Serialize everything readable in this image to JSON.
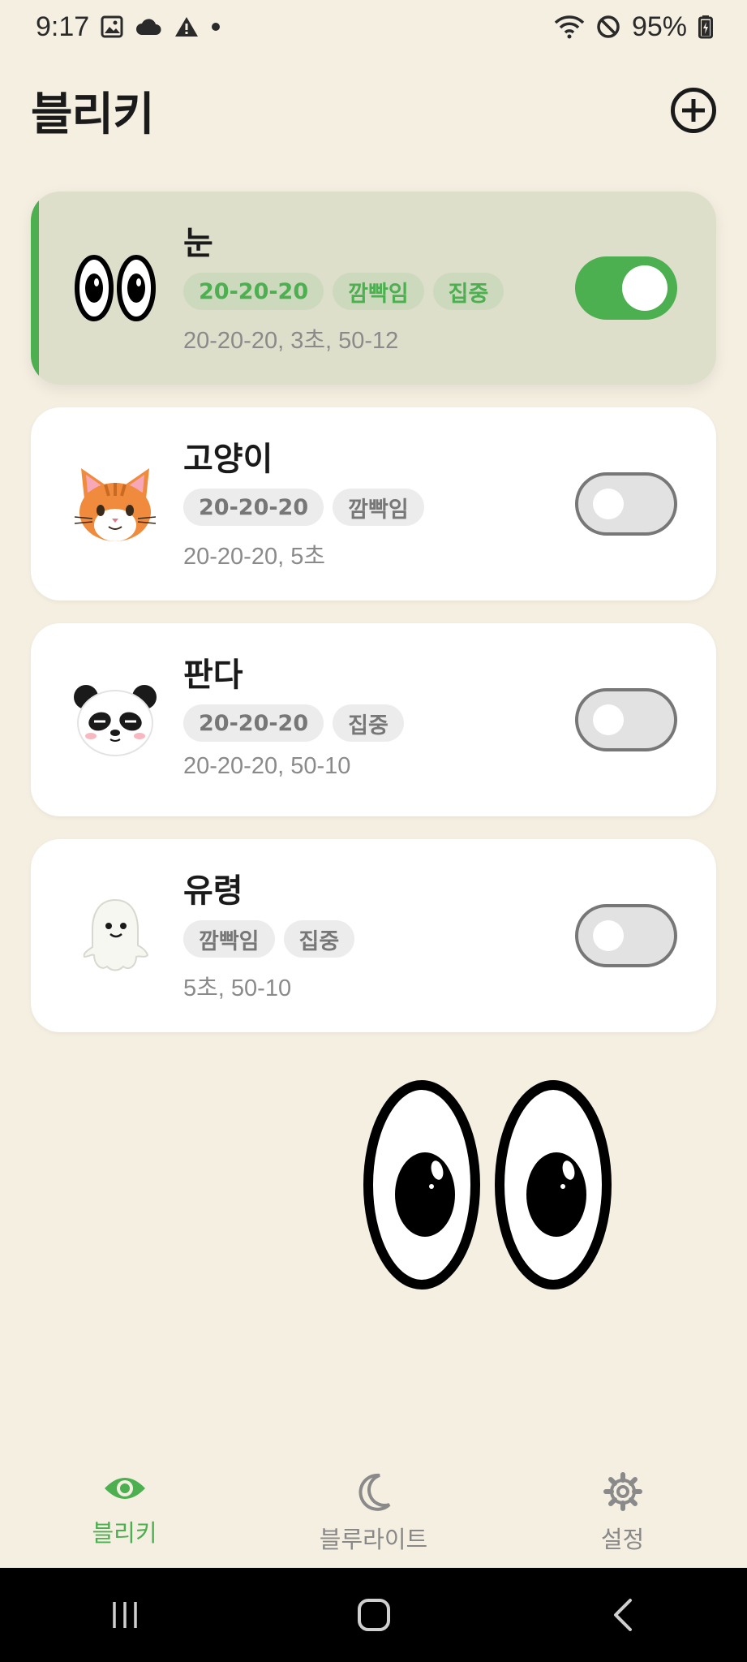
{
  "status_bar": {
    "time": "9:17",
    "battery": "95%"
  },
  "header": {
    "title": "블리키"
  },
  "cards": [
    {
      "name": "눈",
      "tags": [
        "20-20-20",
        "깜빡임",
        "집중"
      ],
      "summary": "20-20-20, 3초, 50-12",
      "enabled": true
    },
    {
      "name": "고양이",
      "tags": [
        "20-20-20",
        "깜빡임"
      ],
      "summary": "20-20-20, 5초",
      "enabled": false
    },
    {
      "name": "판다",
      "tags": [
        "20-20-20",
        "집중"
      ],
      "summary": "20-20-20, 50-10",
      "enabled": false
    },
    {
      "name": "유령",
      "tags": [
        "깜빡임",
        "집중"
      ],
      "summary": "5초, 50-10",
      "enabled": false
    }
  ],
  "nav": [
    {
      "label": "블리키",
      "icon": "eye-icon",
      "active": true
    },
    {
      "label": "블루라이트",
      "icon": "moon-icon",
      "active": false
    },
    {
      "label": "설정",
      "icon": "gear-icon",
      "active": false
    }
  ],
  "colors": {
    "accent": "#4caf50",
    "background": "#f5efe2",
    "active_card": "#dedfcb"
  }
}
